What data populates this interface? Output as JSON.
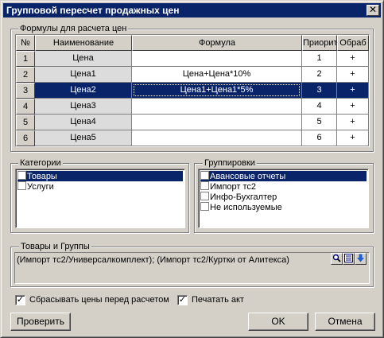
{
  "window": {
    "title": "Групповой пересчет продажных цен",
    "close_glyph": "✕"
  },
  "formulas": {
    "legend": "Формулы для расчета цен",
    "headers": {
      "num": "№",
      "name": "Наименование",
      "formula": "Формула",
      "priority": "Приоритет",
      "process": "Обраб"
    },
    "rows": [
      {
        "num": "1",
        "name": "Цена",
        "formula": "",
        "priority": "1",
        "process": "+",
        "selected": false
      },
      {
        "num": "2",
        "name": "Цена1",
        "formula": "Цена+Цена*10%",
        "priority": "2",
        "process": "+",
        "selected": false
      },
      {
        "num": "3",
        "name": "Цена2",
        "formula": "Цена1+Цена1*5%",
        "priority": "3",
        "process": "+",
        "selected": true
      },
      {
        "num": "4",
        "name": "Цена3",
        "formula": "",
        "priority": "4",
        "process": "+",
        "selected": false
      },
      {
        "num": "5",
        "name": "Цена4",
        "formula": "",
        "priority": "5",
        "process": "+",
        "selected": false
      },
      {
        "num": "6",
        "name": "Цена5",
        "formula": "",
        "priority": "6",
        "process": "+",
        "selected": false
      }
    ]
  },
  "categories": {
    "legend": "Категории",
    "items": [
      {
        "label": "Товары",
        "checked": false,
        "selected": true
      },
      {
        "label": "Услуги",
        "checked": false,
        "selected": false
      }
    ]
  },
  "groupings": {
    "legend": "Группировки",
    "items": [
      {
        "label": "Авансовые отчеты",
        "checked": false,
        "selected": true
      },
      {
        "label": "Импорт тс2",
        "checked": false,
        "selected": false
      },
      {
        "label": "Инфо-Бухгалтер",
        "checked": false,
        "selected": false
      },
      {
        "label": "Не используемые",
        "checked": false,
        "selected": false
      }
    ]
  },
  "goods_groups": {
    "legend": "Товары и Группы",
    "value": "(Импорт тс2/Универсалкомплект); (Импорт тс2/Куртки от Алитекса)",
    "icons": [
      "search-icon",
      "list-icon",
      "arrow-down-icon"
    ]
  },
  "options": {
    "reset_prices": {
      "label": "Сбрасывать цены перед расчетом",
      "checked": true
    },
    "print_act": {
      "label": "Печатать акт",
      "checked": true
    }
  },
  "buttons": {
    "check": "Проверить",
    "ok": "OK",
    "cancel": "Отмена"
  },
  "colors": {
    "selection": "#0a246a",
    "face": "#d4d0c8"
  }
}
